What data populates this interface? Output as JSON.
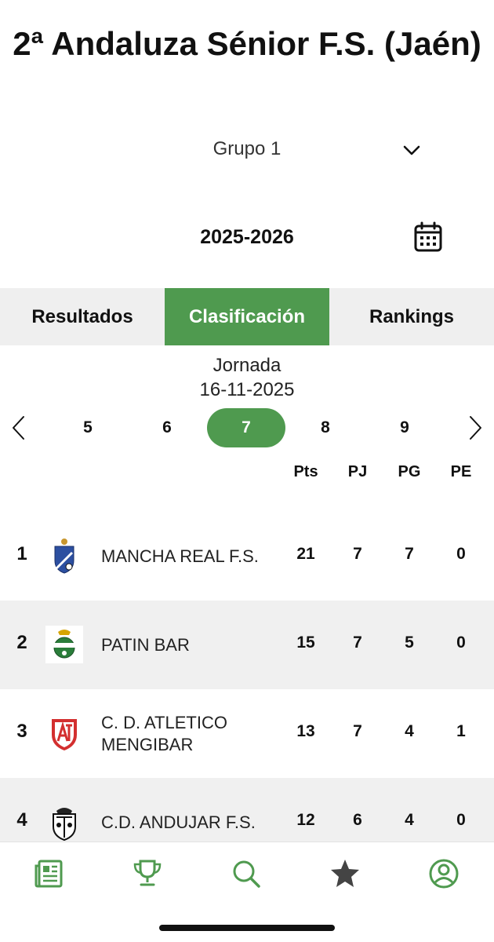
{
  "header": {
    "title": "2ª Andaluza Sénior F.S. (Jaén)"
  },
  "group_select": {
    "value": "Grupo 1",
    "icon": "chevron-down-icon"
  },
  "season": {
    "value": "2025-2026",
    "icon": "calendar-icon"
  },
  "tabs": [
    {
      "label": "Resultados",
      "active": false
    },
    {
      "label": "Clasificación",
      "active": true
    },
    {
      "label": "Rankings",
      "active": false
    }
  ],
  "jornada": {
    "label": "Jornada",
    "date": "16-11-2025"
  },
  "rounds": {
    "items": [
      "5",
      "6",
      "7",
      "8",
      "9"
    ],
    "selected": "7"
  },
  "table": {
    "columns": [
      "Pts",
      "PJ",
      "PG",
      "PE"
    ],
    "rows": [
      {
        "pos": "1",
        "team": "MANCHA REAL F.S.",
        "pts": "21",
        "pj": "7",
        "pg": "7",
        "pe": "0"
      },
      {
        "pos": "2",
        "team": "PATIN BAR",
        "pts": "15",
        "pj": "7",
        "pg": "5",
        "pe": "0"
      },
      {
        "pos": "3",
        "team": "C. D. ATLETICO MENGIBAR",
        "pts": "13",
        "pj": "7",
        "pg": "4",
        "pe": "1"
      },
      {
        "pos": "4",
        "team": "C.D. ANDUJAR F.S.",
        "pts": "12",
        "pj": "6",
        "pg": "4",
        "pe": "0"
      }
    ]
  },
  "bottom_nav": [
    "news-icon",
    "trophy-icon",
    "search-icon",
    "star-icon",
    "profile-icon"
  ],
  "colors": {
    "accent": "#4f9a4f",
    "tab_bg": "#efefef",
    "row_alt": "#f0f0f0"
  }
}
